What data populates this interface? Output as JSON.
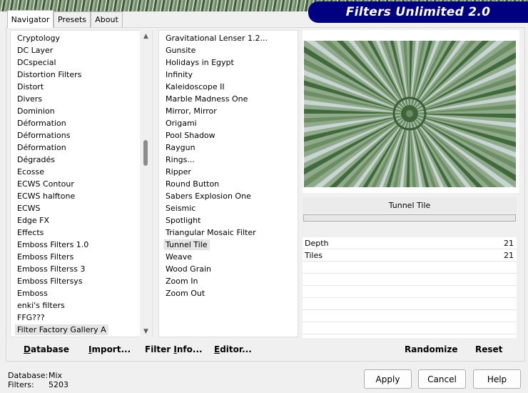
{
  "window": {
    "title": "Filters Unlimited 2.0"
  },
  "tabs": [
    {
      "label": "Navigator"
    },
    {
      "label": "Presets"
    },
    {
      "label": "About"
    }
  ],
  "categories": {
    "items": [
      "Cryptology",
      "DC Layer",
      "DCspecial",
      "Distortion Filters",
      "Distort",
      "Divers",
      "Dominion",
      "Déformation",
      "Déformations",
      "Déformation",
      "Dégradés",
      "Ecosse",
      "ECWS Contour",
      "ECWS halftone",
      "ECWS",
      "Edge FX",
      "Effects",
      "Emboss Filters 1.0",
      "Emboss Filters",
      "Emboss Filterss 3",
      "Emboss Filtersys",
      "Emboss",
      "enki's filters",
      "FFG???",
      "Filter Factory Gallery A"
    ],
    "selected": "Filter Factory Gallery A"
  },
  "filters": {
    "items": [
      "Gravitational Lenser 1.2...",
      "Gunsite",
      "Holidays in Egypt",
      "Infinity",
      "Kaleidoscope II",
      "Marble Madness One",
      "Mirror, Mirror",
      "Origami",
      "Pool Shadow",
      "Raygun",
      "Rings...",
      "Ripper",
      "Round Button",
      "Sabers Explosion One",
      "Seismic",
      "Spotlight",
      "Triangular Mosaic Filter",
      "Tunnel Tile",
      "Weave",
      "Wood Grain",
      "Zoom In",
      "Zoom Out"
    ],
    "selected": "Tunnel Tile"
  },
  "preview": {
    "filter_name": "Tunnel Tile"
  },
  "params": [
    {
      "label": "Depth",
      "value": "21"
    },
    {
      "label": "Tiles",
      "value": "21"
    }
  ],
  "toolbar": {
    "database_ul": "D",
    "database_rest": "atabase",
    "import_pre": "",
    "import_ul": "I",
    "import_rest": "mport...",
    "filterinfo_pre": "Filter ",
    "filterinfo_ul": "I",
    "filterinfo_rest": "nfo...",
    "editor_ul": "E",
    "editor_rest": "ditor...",
    "randomize": "Randomize",
    "reset": "Reset"
  },
  "status": {
    "database_label": "Database:",
    "database_value": "Mix",
    "filters_label": "Filters:",
    "filters_value": "5203"
  },
  "buttons": {
    "apply": "Apply",
    "cancel": "Cancel",
    "help": "Help"
  },
  "icons": {
    "scroll_up": "▲",
    "scroll_down": "▼"
  }
}
